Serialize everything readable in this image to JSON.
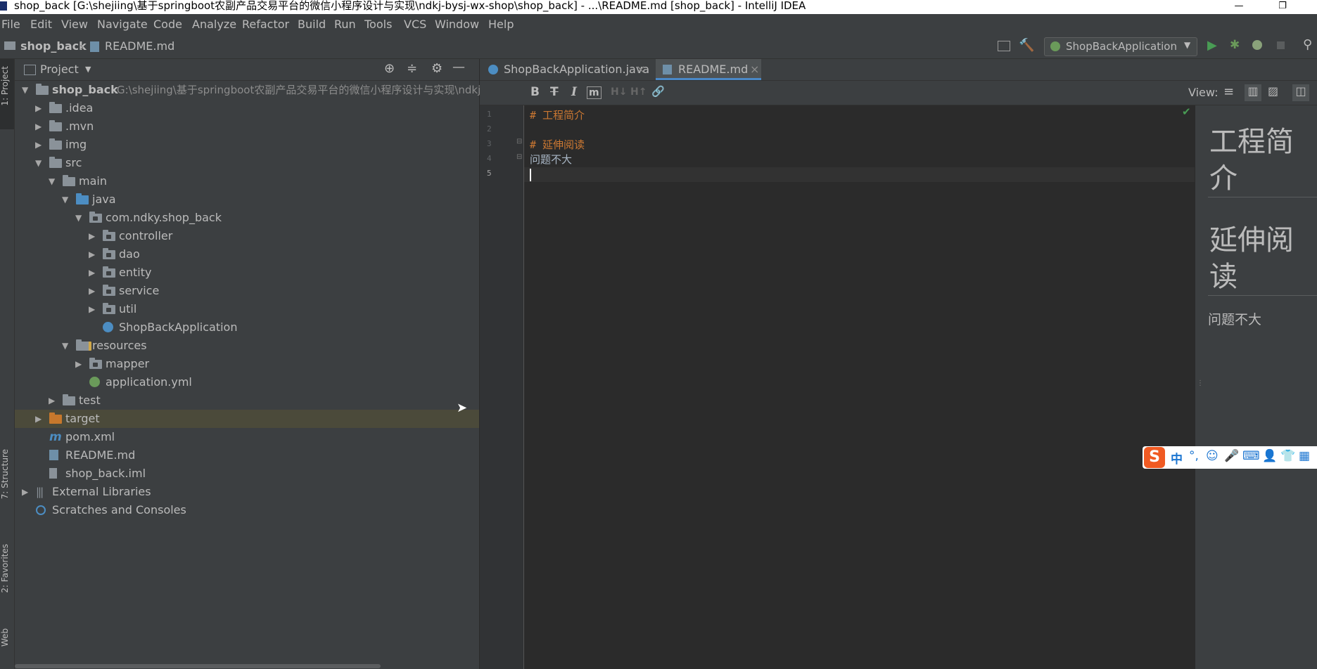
{
  "window": {
    "title": "shop_back [G:\\shejiing\\基于springboot农副产品交易平台的微信小程序设计与实现\\ndkj-bysj-wx-shop\\shop_back] - ...\\README.md [shop_back] - IntelliJ IDEA",
    "minimize": "—",
    "restore": "❐"
  },
  "menu": [
    "File",
    "Edit",
    "View",
    "Navigate",
    "Code",
    "Analyze",
    "Refactor",
    "Build",
    "Run",
    "Tools",
    "VCS",
    "Window",
    "Help"
  ],
  "breadcrumb": {
    "project": "shop_back",
    "file": "README.md"
  },
  "run_config": {
    "label": "ShopBackApplication"
  },
  "left_strip": {
    "project": "1: Project",
    "structure": "7: Structure",
    "favorites": "2: Favorites",
    "web": "Web"
  },
  "project_panel": {
    "title": "Project",
    "tree": [
      {
        "label": "shop_back",
        "path": "G:\\shejiing\\基于springboot农副产品交易平台的微信小程序设计与实现\\ndkj-",
        "depth": 0,
        "expanded": true,
        "kind": "module"
      },
      {
        "label": ".idea",
        "depth": 1,
        "expanded": false,
        "kind": "folder"
      },
      {
        "label": ".mvn",
        "depth": 1,
        "expanded": false,
        "kind": "folder"
      },
      {
        "label": "img",
        "depth": 1,
        "expanded": false,
        "kind": "folder"
      },
      {
        "label": "src",
        "depth": 1,
        "expanded": true,
        "kind": "folder"
      },
      {
        "label": "main",
        "depth": 2,
        "expanded": true,
        "kind": "folder"
      },
      {
        "label": "java",
        "depth": 3,
        "expanded": true,
        "kind": "folder-blue"
      },
      {
        "label": "com.ndky.shop_back",
        "depth": 4,
        "expanded": true,
        "kind": "package"
      },
      {
        "label": "controller",
        "depth": 5,
        "expanded": false,
        "kind": "package"
      },
      {
        "label": "dao",
        "depth": 5,
        "expanded": false,
        "kind": "package"
      },
      {
        "label": "entity",
        "depth": 5,
        "expanded": false,
        "kind": "package"
      },
      {
        "label": "service",
        "depth": 5,
        "expanded": false,
        "kind": "package"
      },
      {
        "label": "util",
        "depth": 5,
        "expanded": false,
        "kind": "package"
      },
      {
        "label": "ShopBackApplication",
        "depth": 5,
        "kind": "spring-class"
      },
      {
        "label": "resources",
        "depth": 3,
        "expanded": true,
        "kind": "resources"
      },
      {
        "label": "mapper",
        "depth": 4,
        "expanded": false,
        "kind": "package"
      },
      {
        "label": "application.yml",
        "depth": 4,
        "kind": "yml"
      },
      {
        "label": "test",
        "depth": 2,
        "expanded": false,
        "kind": "folder"
      },
      {
        "label": "target",
        "depth": 1,
        "expanded": false,
        "kind": "folder-orange",
        "selected": true
      },
      {
        "label": "pom.xml",
        "depth": 1,
        "kind": "maven"
      },
      {
        "label": "README.md",
        "depth": 1,
        "kind": "md"
      },
      {
        "label": "shop_back.iml",
        "depth": 1,
        "kind": "iml"
      },
      {
        "label": "External Libraries",
        "depth": 0,
        "expanded": false,
        "kind": "libs"
      },
      {
        "label": "Scratches and Consoles",
        "depth": 0,
        "kind": "scratch"
      }
    ]
  },
  "tabs": [
    {
      "label": "ShopBackApplication.java",
      "active": false
    },
    {
      "label": "README.md",
      "active": true
    }
  ],
  "md_toolbar": {
    "view_label": "View:"
  },
  "code_lines": [
    {
      "num": "1",
      "text": "# 工程简介",
      "heading": true
    },
    {
      "num": "2",
      "text": "",
      "heading": false
    },
    {
      "num": "3",
      "text": "# 延伸阅读",
      "heading": true
    },
    {
      "num": "4",
      "text": "问题不大",
      "heading": false
    },
    {
      "num": "5",
      "text": "",
      "heading": false
    }
  ],
  "preview": {
    "h1_a": "工程简介",
    "h1_b": "延伸阅读",
    "para": "问题不大"
  },
  "ime": {
    "logo": "S",
    "mode": "中",
    "punct": "°,",
    "emoji": "☺",
    "mic": "🎤",
    "kbd": "⌨",
    "user": "👤",
    "shirt": "👕",
    "grid": "▦"
  },
  "colors": {
    "accent": "#4a88c7",
    "selection": "#4b4a3a",
    "run_green": "#499c54",
    "heading_text": "#cc7832"
  }
}
